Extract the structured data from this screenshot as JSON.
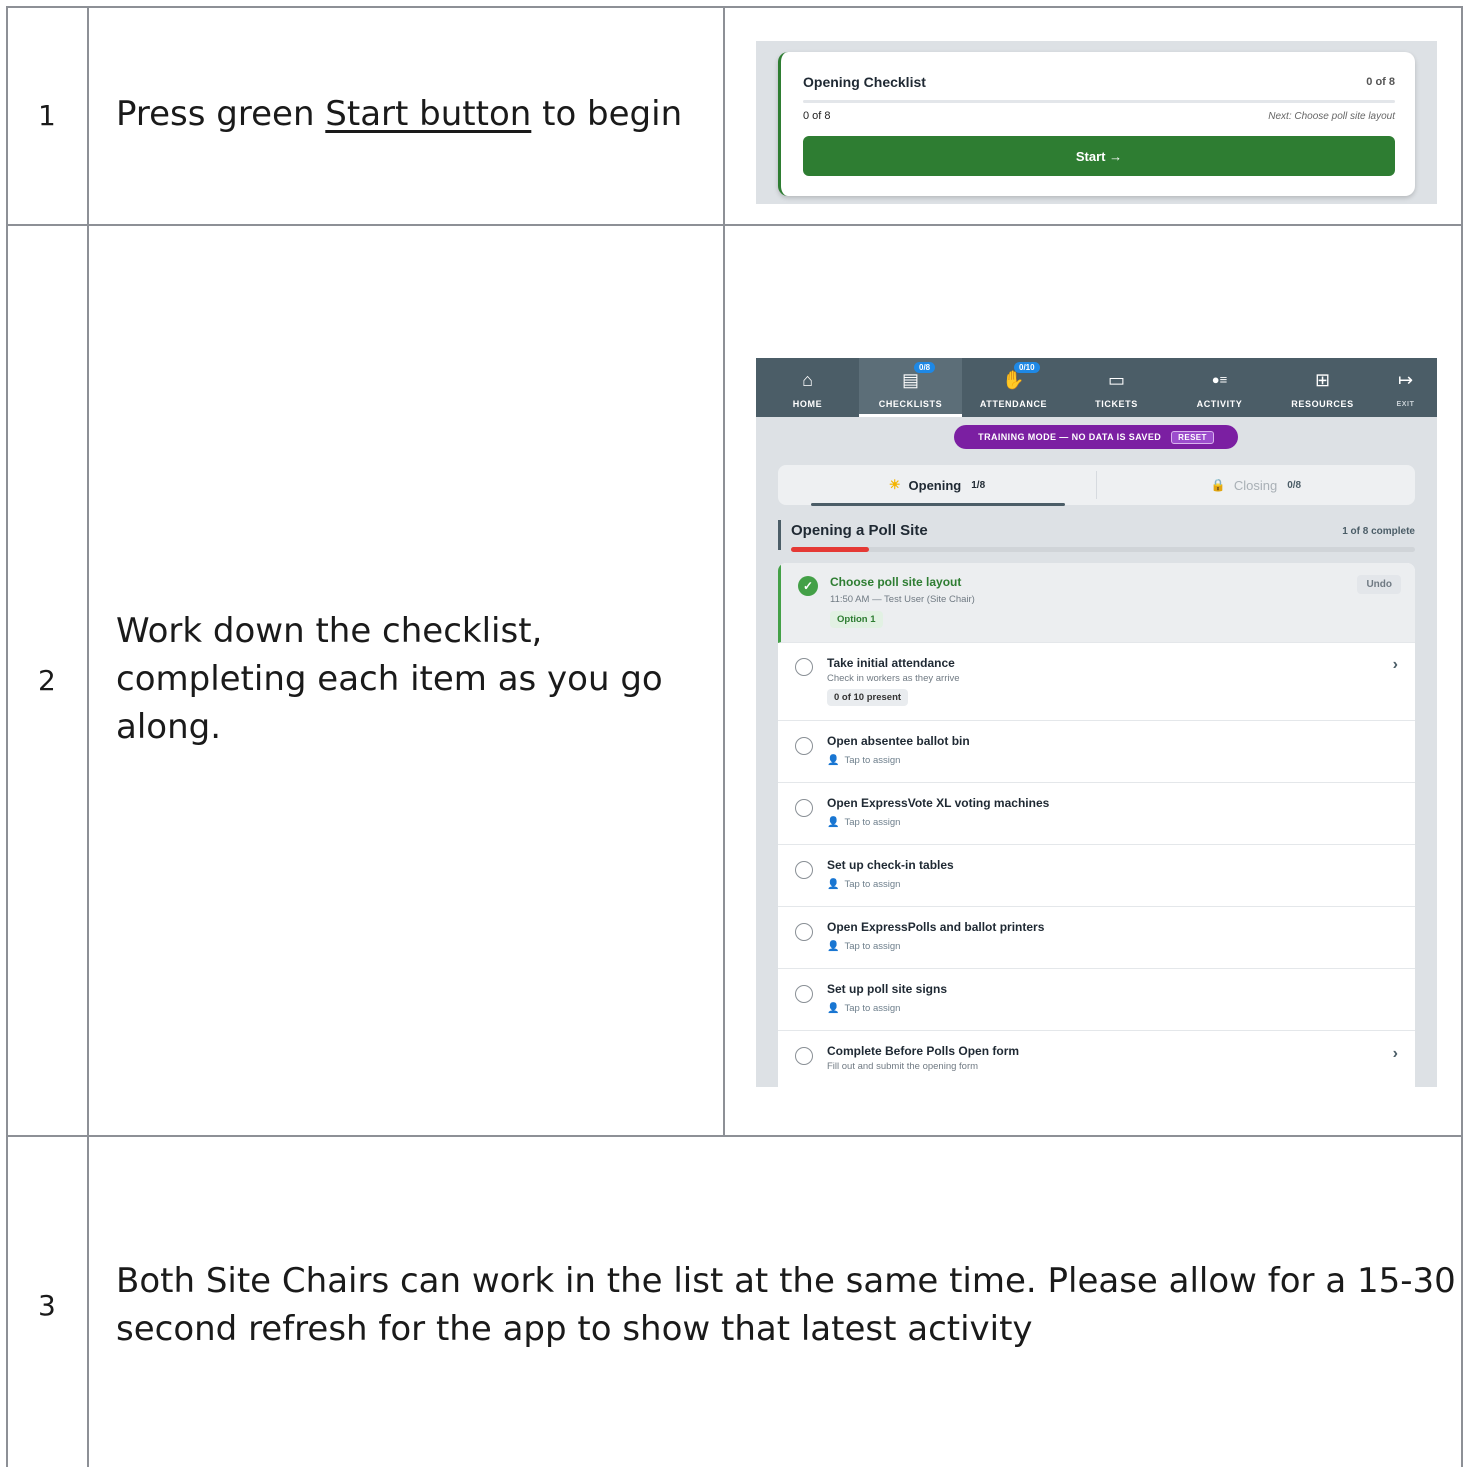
{
  "steps": [
    {
      "number": "1",
      "text_before": "Press green ",
      "link_text": "Start button",
      "text_after": " to begin"
    },
    {
      "number": "2",
      "line1": "Work down the checklist,",
      "line2": "completing each item as you go",
      "line3": "along."
    },
    {
      "number": "3",
      "line1": "Both Site Chairs can work in the list at the same time. Please allow for a 15-30",
      "line2": "second refresh for the app to show that latest activity"
    }
  ],
  "screenshot1": {
    "title": "Opening Checklist",
    "count": "0 of 8",
    "progress": "0 of 8",
    "next": "Next: Choose poll site layout",
    "start_label": "Start →",
    "progress_fraction": 0
  },
  "screenshot2": {
    "nav": [
      {
        "label": "HOME",
        "icon": "home-icon",
        "glyph": "⌂"
      },
      {
        "label": "CHECKLISTS",
        "icon": "clipboard-icon",
        "glyph": "▤",
        "badge": "0/8",
        "active": true
      },
      {
        "label": "ATTENDANCE",
        "icon": "wave-hand-icon",
        "glyph": "✋",
        "badge": "0/10"
      },
      {
        "label": "TICKETS",
        "icon": "ticket-icon",
        "glyph": "▭"
      },
      {
        "label": "ACTIVITY",
        "icon": "activity-icon",
        "glyph": "●≡"
      },
      {
        "label": "RESOURCES",
        "icon": "book-icon",
        "glyph": "⊞"
      },
      {
        "label": "EXIT",
        "icon": "exit-icon",
        "glyph": "↦"
      }
    ],
    "training_banner": "TRAINING MODE  —  NO DATA IS SAVED",
    "reset_label": "RESET",
    "tabs": [
      {
        "label": "Opening",
        "count": "1/8",
        "icon": "sun-icon",
        "glyph": "☀",
        "active": true
      },
      {
        "label": "Closing",
        "count": "0/8",
        "icon": "lock-icon",
        "glyph": "🔒",
        "active": false
      }
    ],
    "section_title": "Opening a Poll Site",
    "section_count": "1 of 8 complete",
    "section_progress_fraction": 0.125,
    "undo_label": "Undo",
    "items": [
      {
        "title": "Choose poll site layout",
        "sub": "11:50 AM — Test User (Site Chair)",
        "pill": "Option 1"
      },
      {
        "title": "Take initial attendance",
        "sub": "Check in workers as they arrive",
        "pill": "0 of 10 present"
      },
      {
        "title": "Open absentee ballot bin",
        "assign": "Tap to assign"
      },
      {
        "title": "Open ExpressVote XL voting machines",
        "assign": "Tap to assign"
      },
      {
        "title": "Set up check-in tables",
        "assign": "Tap to assign"
      },
      {
        "title": "Open ExpressPolls and ballot printers",
        "assign": "Tap to assign"
      },
      {
        "title": "Set up poll site signs",
        "assign": "Tap to assign"
      },
      {
        "title": "Complete Before Polls Open form",
        "sub": "Fill out and submit the opening form"
      }
    ],
    "colors": {
      "nav": "#4b5d67",
      "green": "#2e7d32",
      "training": "#7b1fa2",
      "progress_red": "#e53935",
      "badge_blue": "#1e88e5"
    }
  }
}
